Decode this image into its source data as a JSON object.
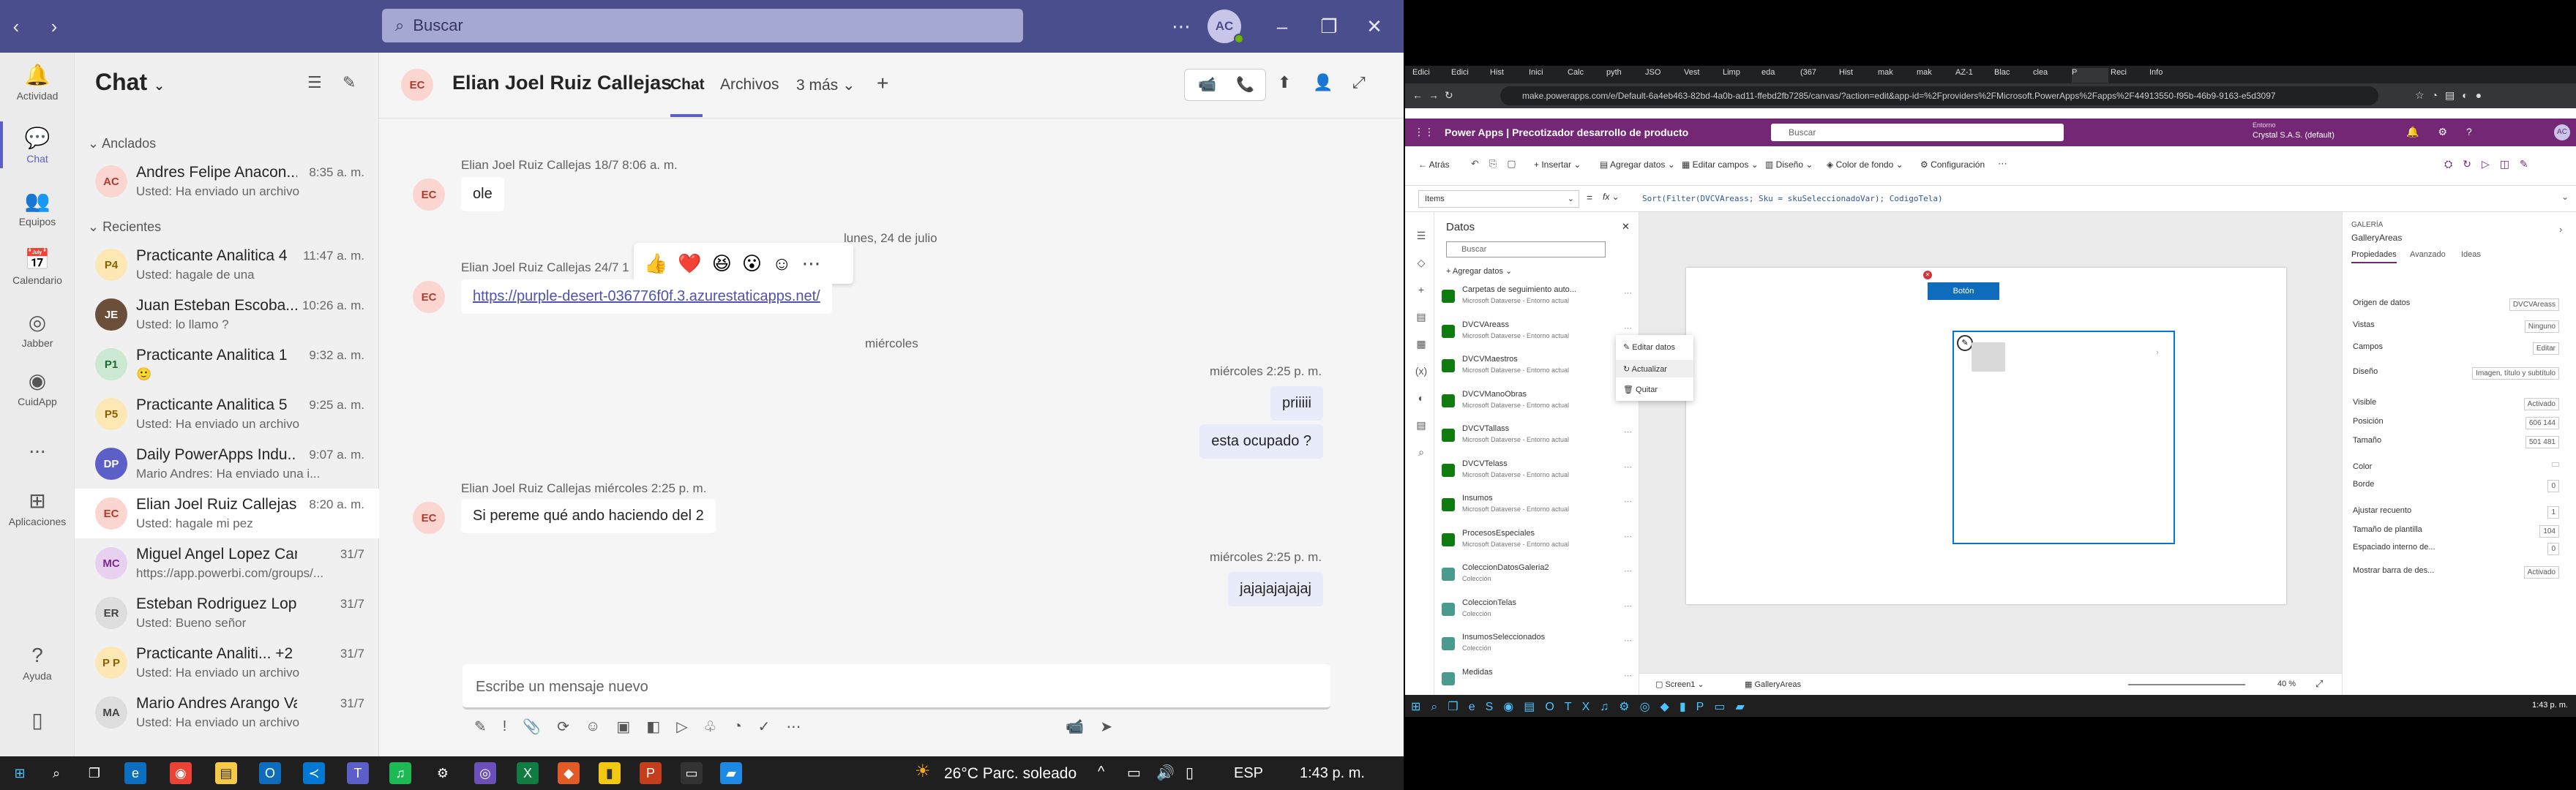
{
  "teams": {
    "search_placeholder": "Buscar",
    "avatar_initials": "AC",
    "rail": [
      {
        "label": "Actividad",
        "icon": "bell-icon"
      },
      {
        "label": "Chat",
        "icon": "chat-icon"
      },
      {
        "label": "Equipos",
        "icon": "teams-icon"
      },
      {
        "label": "Calendario",
        "icon": "calendar-icon"
      },
      {
        "label": "Jabber",
        "icon": "jabber-icon"
      },
      {
        "label": "CuidApp",
        "icon": "cuidapp-icon"
      },
      {
        "label": "...",
        "icon": "more-icon"
      },
      {
        "label": "Aplicaciones",
        "icon": "apps-icon"
      },
      {
        "label": "Ayuda",
        "icon": "help-icon"
      }
    ],
    "chatlist": {
      "title": "Chat",
      "pinned_label": "Anclados",
      "recent_label": "Recientes",
      "pinned": [
        {
          "initials": "AC",
          "name": "Andres Felipe Anacon...",
          "time": "8:35 a. m.",
          "preview": "Usted: Ha enviado un archivo",
          "bg": "#fbd5cf",
          "fg": "#b13c2c"
        }
      ],
      "recent": [
        {
          "initials": "P4",
          "name": "Practicante Analitica 4",
          "time": "11:47 a. m.",
          "preview": "Usted: hagale de una",
          "bg": "#fde7b5",
          "fg": "#8a6100"
        },
        {
          "initials": "JE",
          "name": "Juan Esteban Escoba...",
          "time": "10:26 a. m.",
          "preview": "Usted: lo llamo ?",
          "bg": "#6b4f3a",
          "fg": "#fff"
        },
        {
          "initials": "P1",
          "name": "Practicante Analitica 1",
          "time": "9:32 a. m.",
          "preview": "🙂",
          "bg": "#cbe8d3",
          "fg": "#1d6b34"
        },
        {
          "initials": "P5",
          "name": "Practicante Analitica 5",
          "time": "9:25 a. m.",
          "preview": "Usted: Ha enviado un archivo",
          "bg": "#fde7b5",
          "fg": "#8a6100"
        },
        {
          "initials": "DP",
          "name": "Daily PowerApps Indu...",
          "time": "9:07 a. m.",
          "preview": "Mario Andres: Ha enviado una i...",
          "bg": "#5b5fc7",
          "fg": "#fff"
        },
        {
          "initials": "EC",
          "name": "Elian Joel Ruiz Callejas",
          "time": "8:20 a. m.",
          "preview": "Usted: hagale mi pez",
          "bg": "#fbd5cf",
          "fg": "#b13c2c",
          "selected": true
        },
        {
          "initials": "MC",
          "name": "Miguel Angel Lopez Card...",
          "time": "31/7",
          "preview": "https://app.powerbi.com/groups/...",
          "bg": "#e7d0f0",
          "fg": "#7a2b8f"
        },
        {
          "initials": "ER",
          "name": "Esteban Rodriguez Lopez",
          "time": "31/7",
          "preview": "Usted: Bueno señor",
          "bg": "#ddd",
          "fg": "#444"
        },
        {
          "initials": "P P",
          "name": "Practicante Analiti... +2",
          "time": "31/7",
          "preview": "Usted: Ha enviado un archivo",
          "bg": "#fde7b5",
          "fg": "#8a6100"
        },
        {
          "initials": "MA",
          "name": "Mario Andres Arango Vasco",
          "time": "31/7",
          "preview": "Usted: Ha enviado un archivo",
          "bg": "#ddd",
          "fg": "#444"
        }
      ]
    },
    "chat": {
      "contact_initials": "EC",
      "contact_name": "Elian Joel Ruiz Callejas",
      "tabs": [
        "Chat",
        "Archivos",
        "3 más"
      ],
      "messages": [
        {
          "meta": "Elian Joel Ruiz Callejas  18/7 8:06 a. m.",
          "text": "ole"
        },
        {
          "divider": "lunes, 24 de julio"
        },
        {
          "meta": "Elian Joel Ruiz Callejas  24/7 1",
          "link": "https://purple-desert-036776f0f.3.azurestaticapps.net/"
        },
        {
          "divider": "miércoles"
        },
        {
          "meta_me": "miércoles 2:25 p. m.",
          "texts": [
            "priiiii",
            "esta ocupado ?"
          ]
        },
        {
          "meta": "Elian Joel Ruiz Callejas  miércoles 2:25 p. m.",
          "text": "Si pereme qué ando haciendo del 2"
        },
        {
          "meta_me2": "miércoles 2:25 p. m.",
          "text": "jajajajajajaj"
        }
      ],
      "composer_placeholder": "Escribe un mensaje nuevo"
    }
  },
  "taskbar": {
    "weather": "26°C  Parc. soleado",
    "lang": "ESP",
    "time": "1:43 p. m."
  },
  "browser": {
    "tabs": [
      "Edici",
      "Edici",
      "Hist",
      "Inici",
      "Calc",
      "pyth",
      "JSO",
      "Vest",
      "Limp",
      "eda",
      "(367",
      "Hist",
      "mak",
      "mak",
      "AZ-1",
      "Blac",
      "clea",
      "P",
      "Reci",
      "Info"
    ],
    "url": "make.powerapps.com/e/Default-6a4eb463-82bd-4a0b-ad11-ffebd2fb7285/canvas/?action=edit&app-id=%2Fproviders%2FMicrosoft.PowerApps%2Fapps%2F44913550-f95b-46b9-9163-e5d3097",
    "app_title": "Power Apps  |  Precotizador desarrollo de producto",
    "search_placeholder": "Buscar",
    "env_label": "Entorno",
    "env_name": "Crystal S.A.S. (default)",
    "cmd": [
      "Atrás",
      "Insertar",
      "Agregar datos",
      "Editar campos",
      "Diseño",
      "Color de fondo",
      "Configuración"
    ],
    "property": "Items",
    "formula": "Sort(Filter(DVCVAreass; Sku = skuSeleccionadoVar); CodigoTela)",
    "data_pane": {
      "title": "Datos",
      "search": "Buscar",
      "add": "Agregar datos",
      "sources": [
        {
          "name": "Carpetas de seguimiento auto...",
          "sub": "Microsoft Dataverse - Entorno actual",
          "type": "table"
        },
        {
          "name": "DVCVAreass",
          "sub": "Microsoft Dataverse - Entorno actual",
          "type": "table"
        },
        {
          "name": "DVCVMaestros",
          "sub": "Microsoft Dataverse - Entorno actual",
          "type": "table"
        },
        {
          "name": "DVCVManoObras",
          "sub": "Microsoft Dataverse - Entorno actual",
          "type": "table"
        },
        {
          "name": "DVCVTallass",
          "sub": "Microsoft Dataverse - Entorno actual",
          "type": "table"
        },
        {
          "name": "DVCVTelass",
          "sub": "Microsoft Dataverse - Entorno actual",
          "type": "table"
        },
        {
          "name": "Insumos",
          "sub": "Microsoft Dataverse - Entorno actual",
          "type": "table"
        },
        {
          "name": "ProcesosEspeciales",
          "sub": "Microsoft Dataverse - Entorno actual",
          "type": "table"
        },
        {
          "name": "ColeccionDatosGaleria2",
          "sub": "Colección",
          "type": "collection"
        },
        {
          "name": "ColeccionTelas",
          "sub": "Colección",
          "type": "collection"
        },
        {
          "name": "InsumosSeleccionados",
          "sub": "Colección",
          "type": "collection"
        },
        {
          "name": "Medidas",
          "sub": "",
          "type": "collection"
        }
      ],
      "context_menu": [
        "Editar datos",
        "Actualizar",
        "Quitar"
      ]
    },
    "canvas": {
      "button_label": "Botón"
    },
    "props": {
      "section": "GALERÍA",
      "name": "GalleryAreas",
      "tabs": [
        "Propiedades",
        "Avanzado",
        "Ideas"
      ],
      "rows": [
        {
          "label": "Origen de datos",
          "value": "DVCVAreass"
        },
        {
          "label": "Vistas",
          "value": "Ninguno"
        },
        {
          "label": "Campos",
          "value": "Editar"
        },
        {
          "label": "Diseño",
          "value": "Imagen, título y subtítulo"
        },
        {
          "label": "Visible",
          "value": "Activado"
        },
        {
          "label": "Posición",
          "value": "606   144"
        },
        {
          "label": "Tamaño",
          "value": "501   481"
        },
        {
          "label": "Color",
          "value": ""
        },
        {
          "label": "Borde",
          "value": "0"
        },
        {
          "label": "Ajustar recuento",
          "value": "1"
        },
        {
          "label": "Tamaño de plantilla",
          "value": "104"
        },
        {
          "label": "Espaciado interno de...",
          "value": "0"
        },
        {
          "label": "Mostrar barra de des...",
          "value": "Activado"
        }
      ],
      "pos_sub": [
        "X",
        "Y"
      ],
      "size_sub": [
        "Ancho",
        "Alto"
      ]
    },
    "bottom": {
      "screen": "Screen1",
      "gallery": "GalleryAreas",
      "zoom": "40 %"
    },
    "clock": "1:43 p. m."
  }
}
